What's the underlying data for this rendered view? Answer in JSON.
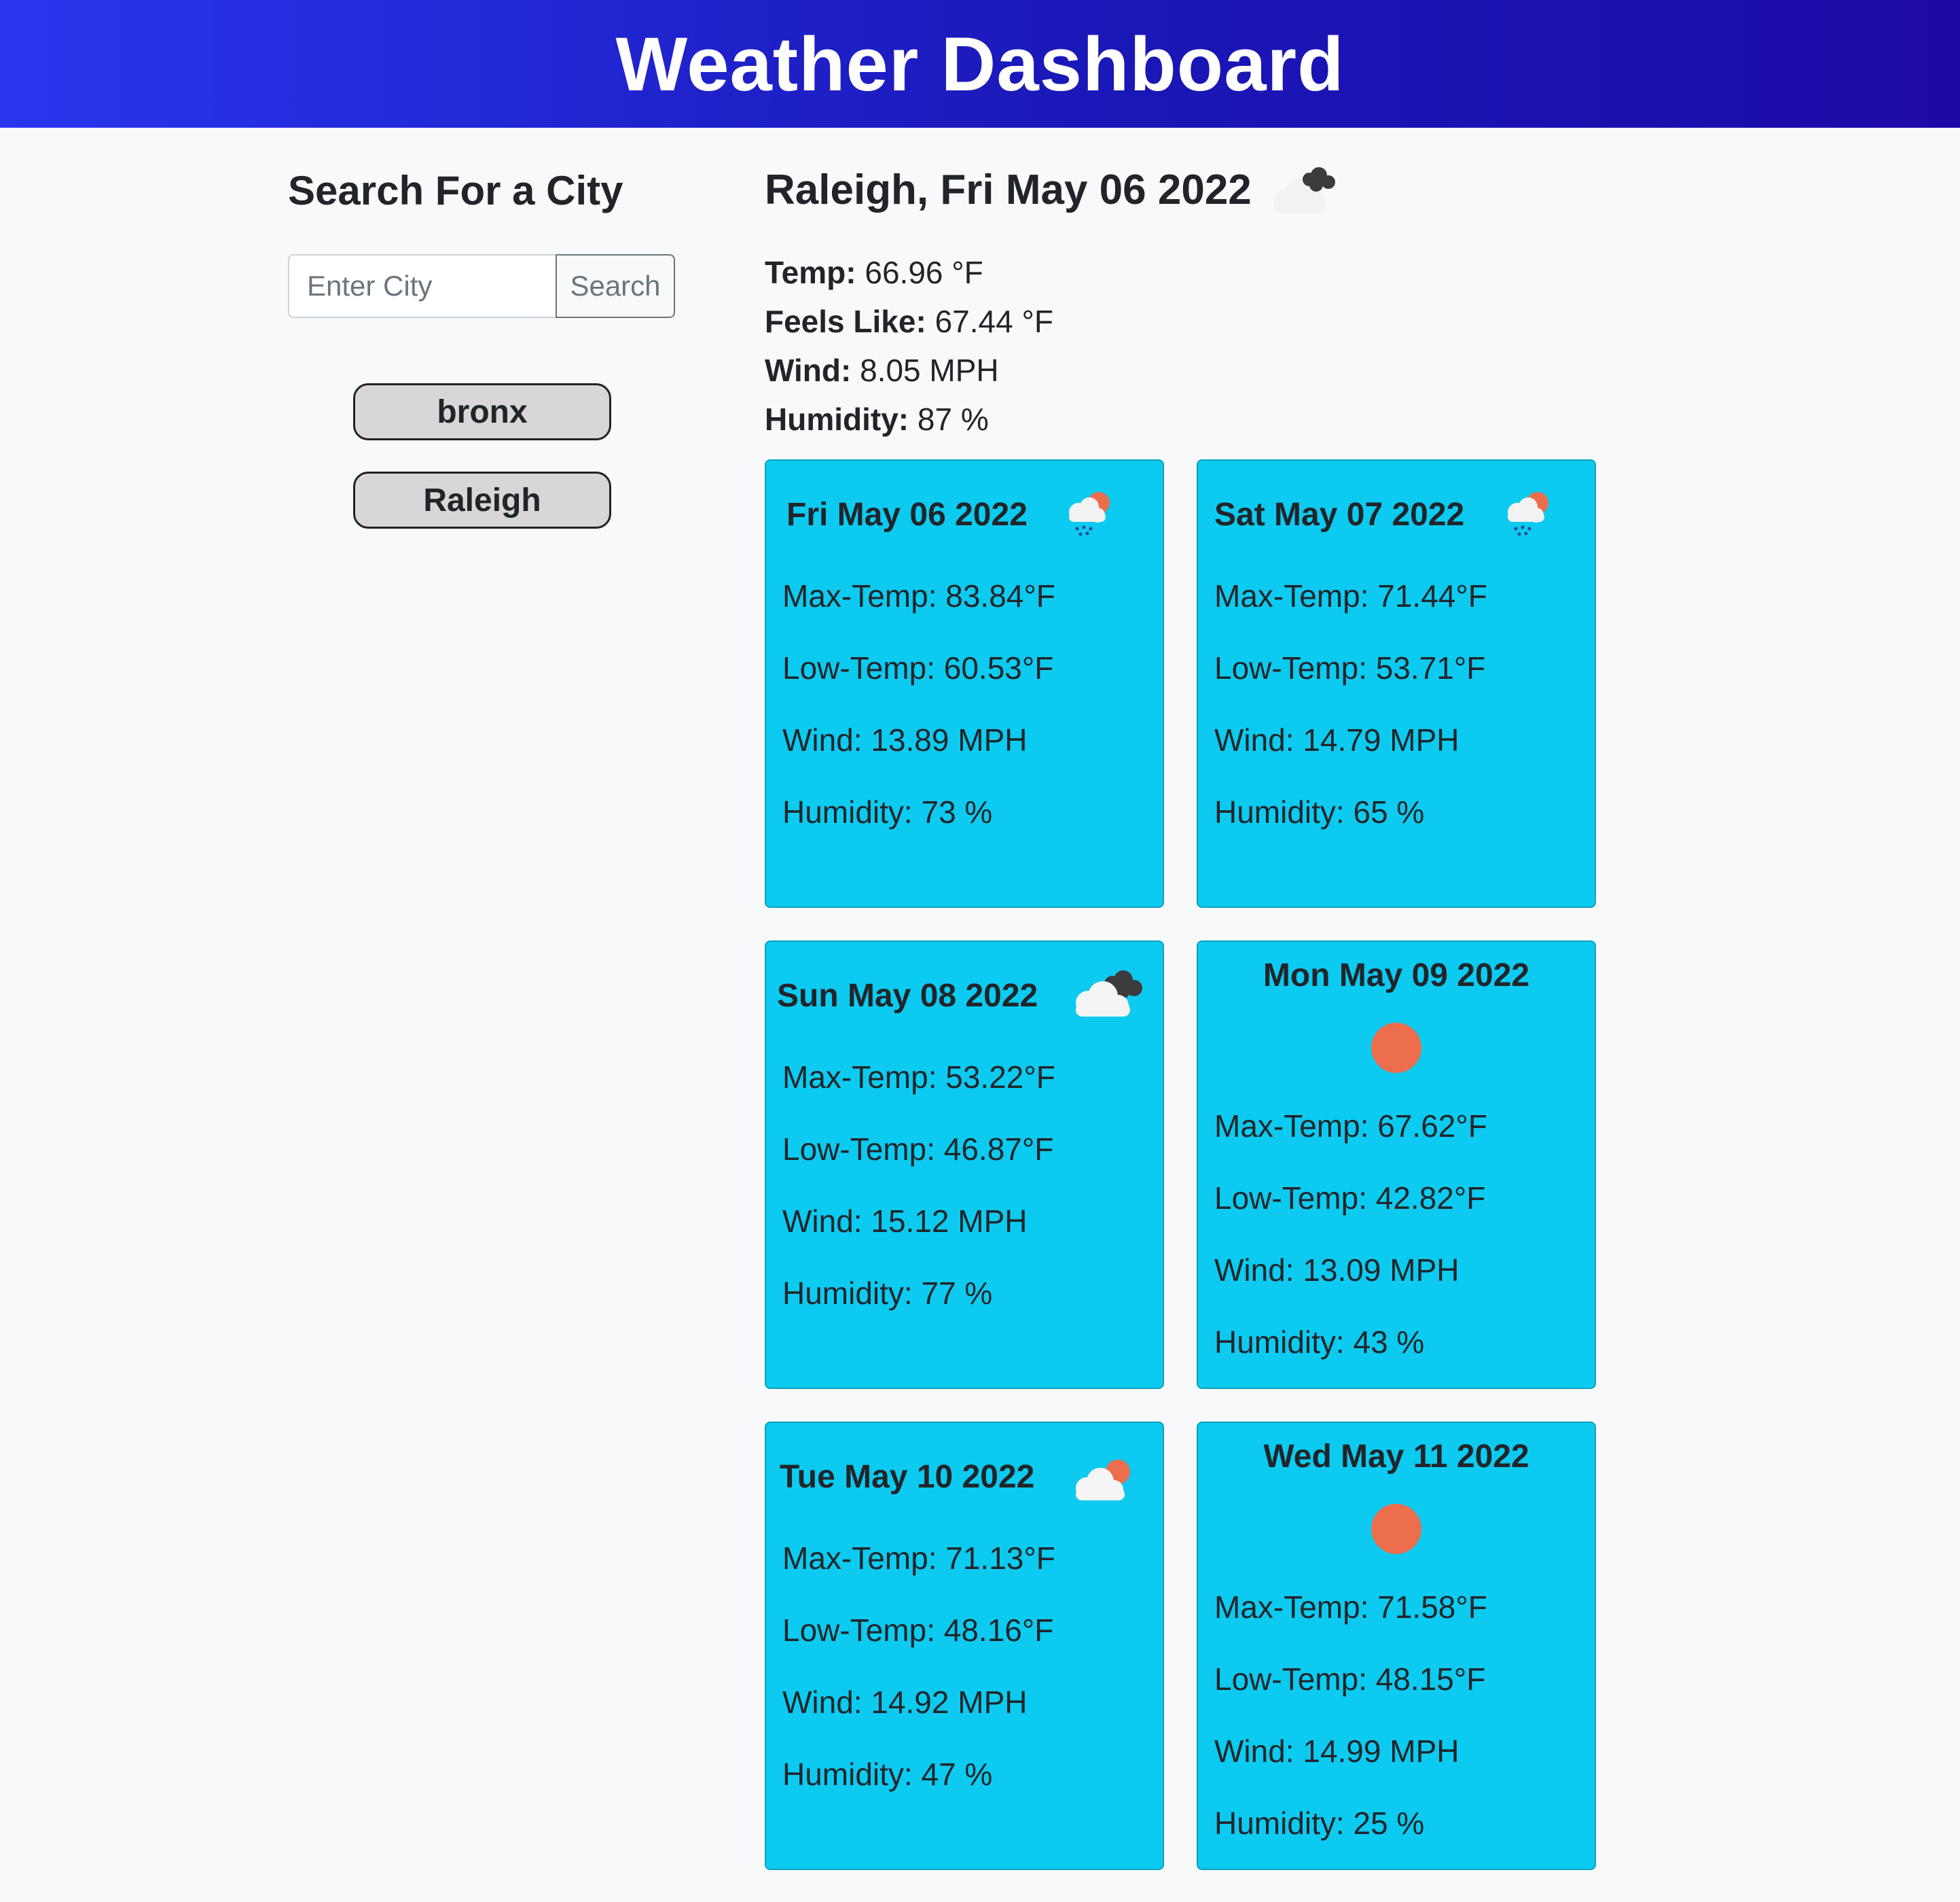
{
  "header": {
    "title": "Weather Dashboard"
  },
  "sidebar": {
    "title": "Search For a City",
    "search": {
      "placeholder": "Enter City",
      "value": "",
      "button_label": "Search"
    },
    "history": [
      "bronx",
      "Raleigh"
    ]
  },
  "current": {
    "title": "Raleigh, Fri May 06 2022",
    "icon": "overcast-cloud-icon",
    "temp_label": "Temp:",
    "temp_value": "66.96 °F",
    "feels_label": "Feels Like:",
    "feels_value": "67.44 °F",
    "wind_label": "Wind:",
    "wind_value": "8.05 MPH",
    "humidity_label": "Humidity:",
    "humidity_value": "87 %"
  },
  "forecast": [
    {
      "date": "Fri May 06 2022",
      "icon": "sun-cloud-rain-icon",
      "max": "Max-Temp: 83.84°F",
      "low": "Low-Temp: 60.53°F",
      "wind": "Wind: 13.89 MPH",
      "humidity": "Humidity: 73 %"
    },
    {
      "date": "Sat May 07 2022",
      "icon": "sun-cloud-rain-icon",
      "max": "Max-Temp: 71.44°F",
      "low": "Low-Temp: 53.71°F",
      "wind": "Wind: 14.79 MPH",
      "humidity": "Humidity: 65 %"
    },
    {
      "date": "Sun May 08 2022",
      "icon": "overcast-cloud-icon",
      "max": "Max-Temp: 53.22°F",
      "low": "Low-Temp: 46.87°F",
      "wind": "Wind: 15.12 MPH",
      "humidity": "Humidity: 77 %"
    },
    {
      "date": "Mon May 09 2022",
      "icon": "sun-icon",
      "max": "Max-Temp: 67.62°F",
      "low": "Low-Temp: 42.82°F",
      "wind": "Wind: 13.09 MPH",
      "humidity": "Humidity: 43 %"
    },
    {
      "date": "Tue May 10 2022",
      "icon": "sun-cloud-icon",
      "max": "Max-Temp: 71.13°F",
      "low": "Low-Temp: 48.16°F",
      "wind": "Wind: 14.92 MPH",
      "humidity": "Humidity: 47 %"
    },
    {
      "date": "Wed May 11 2022",
      "icon": "sun-icon",
      "max": "Max-Temp: 71.58°F",
      "low": "Low-Temp: 48.15°F",
      "wind": "Wind: 14.99 MPH",
      "humidity": "Humidity: 25 %"
    }
  ],
  "colors": {
    "header_gradient_start": "#2936ee",
    "header_gradient_end": "#1d0aa6",
    "card_background": "#0dcaf0",
    "sun": "#ec6e4c",
    "history_button": "#d8d6d6"
  }
}
